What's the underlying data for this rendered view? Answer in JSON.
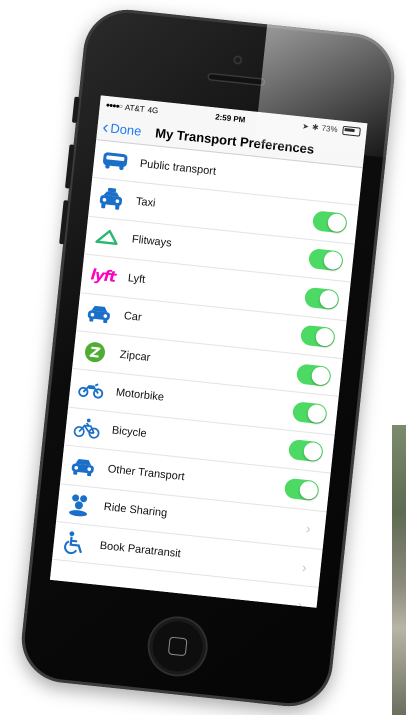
{
  "status_bar": {
    "carrier": "AT&T",
    "network": "4G",
    "time": "2:59 PM",
    "battery": "73%",
    "icons": [
      "signal-dots-icon",
      "location-arrow-icon",
      "bluetooth-icon",
      "battery-icon"
    ]
  },
  "nav": {
    "back_label": "Done",
    "title": "My Transport Preferences"
  },
  "colors": {
    "accent": "#1e7bf2",
    "toggle_on": "#4cd964",
    "icon_blue": "#1a6fc9",
    "lyft_pink": "#ff00bf",
    "flitways_green": "#2bb673",
    "zipcar_green": "#4fae32"
  },
  "preferences": [
    {
      "label": "Public transport",
      "icon": "bus-icon",
      "control": "none"
    },
    {
      "label": "Taxi",
      "icon": "taxi-icon",
      "control": "toggle",
      "enabled": true
    },
    {
      "label": "Flitways",
      "icon": "flitways-logo-icon",
      "control": "toggle",
      "enabled": true
    },
    {
      "label": "Lyft",
      "icon": "lyft-logo-icon",
      "control": "toggle",
      "enabled": true
    },
    {
      "label": "Car",
      "icon": "car-icon",
      "control": "toggle",
      "enabled": true
    },
    {
      "label": "Zipcar",
      "icon": "zipcar-logo-icon",
      "control": "toggle",
      "enabled": true
    },
    {
      "label": "Motorbike",
      "icon": "motorbike-icon",
      "control": "toggle",
      "enabled": true
    },
    {
      "label": "Bicycle",
      "icon": "bicycle-icon",
      "control": "toggle",
      "enabled": true
    },
    {
      "label": "Other Transport",
      "icon": "car-icon",
      "control": "toggle",
      "enabled": true
    },
    {
      "label": "Ride Sharing",
      "icon": "group-icon",
      "control": "disclosure"
    },
    {
      "label": "Book Paratransit",
      "icon": "wheelchair-icon",
      "control": "disclosure"
    },
    {
      "label": "",
      "icon": "",
      "control": "disclosure"
    }
  ]
}
